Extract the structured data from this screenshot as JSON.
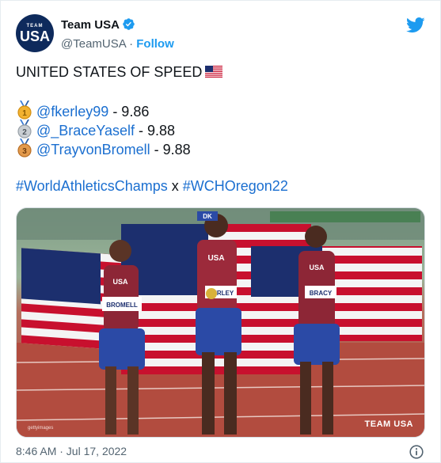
{
  "tweet": {
    "author": {
      "name": "Team USA",
      "handle": "@TeamUSA",
      "separator": "·",
      "follow_label": "Follow",
      "avatar_text_top": "TEAM",
      "avatar_text": "USA"
    },
    "headline": "UNITED STATES OF SPEED",
    "results": [
      {
        "medal": "gold",
        "medal_number": "1",
        "handle": "@fkerley99",
        "time": " - 9.86"
      },
      {
        "medal": "silver",
        "medal_number": "2",
        "handle": "@_BraceYaself",
        "time": " - 9.88"
      },
      {
        "medal": "bronze",
        "medal_number": "3",
        "handle": "@TrayvonBromell",
        "time": " - 9.88"
      }
    ],
    "hashtag_1": "#WorldAthleticsChamps",
    "hashtag_joiner": " x ",
    "hashtag_2": "#WCHOregon22",
    "media": {
      "watermark": "TEAM USA",
      "credit": "gettyimages",
      "bib_left": "BROMELL",
      "bib_center": "KERLEY",
      "bib_right": "BRACY",
      "jersey_text": "USA",
      "banner_text": "DK"
    },
    "timestamp": "8:46 AM · Jul 17, 2022"
  },
  "icons": {
    "verified": "verified-badge-icon",
    "twitter": "twitter-bird-icon",
    "flag": "us-flag-icon",
    "info": "info-icon"
  },
  "colors": {
    "link": "#1b6fd0",
    "verified": "#1d9bf0",
    "twitter_blue": "#1d9bf0",
    "track": "#b24c3f",
    "usa_red": "#c8102e",
    "usa_blue": "#1c2f6e"
  }
}
